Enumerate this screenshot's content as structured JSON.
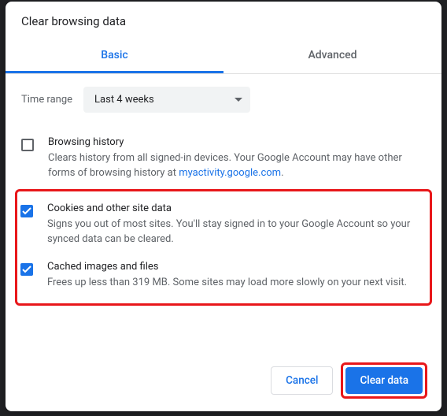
{
  "dialog": {
    "title": "Clear browsing data"
  },
  "tabs": {
    "basic": "Basic",
    "advanced": "Advanced"
  },
  "timeRange": {
    "label": "Time range",
    "value": "Last 4 weeks"
  },
  "options": {
    "browsingHistory": {
      "checked": false,
      "title": "Browsing history",
      "descPrefix": "Clears history from all signed-in devices. Your Google Account may have other forms of browsing history at ",
      "linkText": "myactivity.google.com",
      "descSuffix": "."
    },
    "cookies": {
      "checked": true,
      "title": "Cookies and other site data",
      "desc": "Signs you out of most sites. You'll stay signed in to your Google Account so your synced data can be cleared."
    },
    "cache": {
      "checked": true,
      "title": "Cached images and files",
      "desc": "Frees up less than 319 MB. Some sites may load more slowly on your next visit."
    }
  },
  "buttons": {
    "cancel": "Cancel",
    "clear": "Clear data"
  }
}
